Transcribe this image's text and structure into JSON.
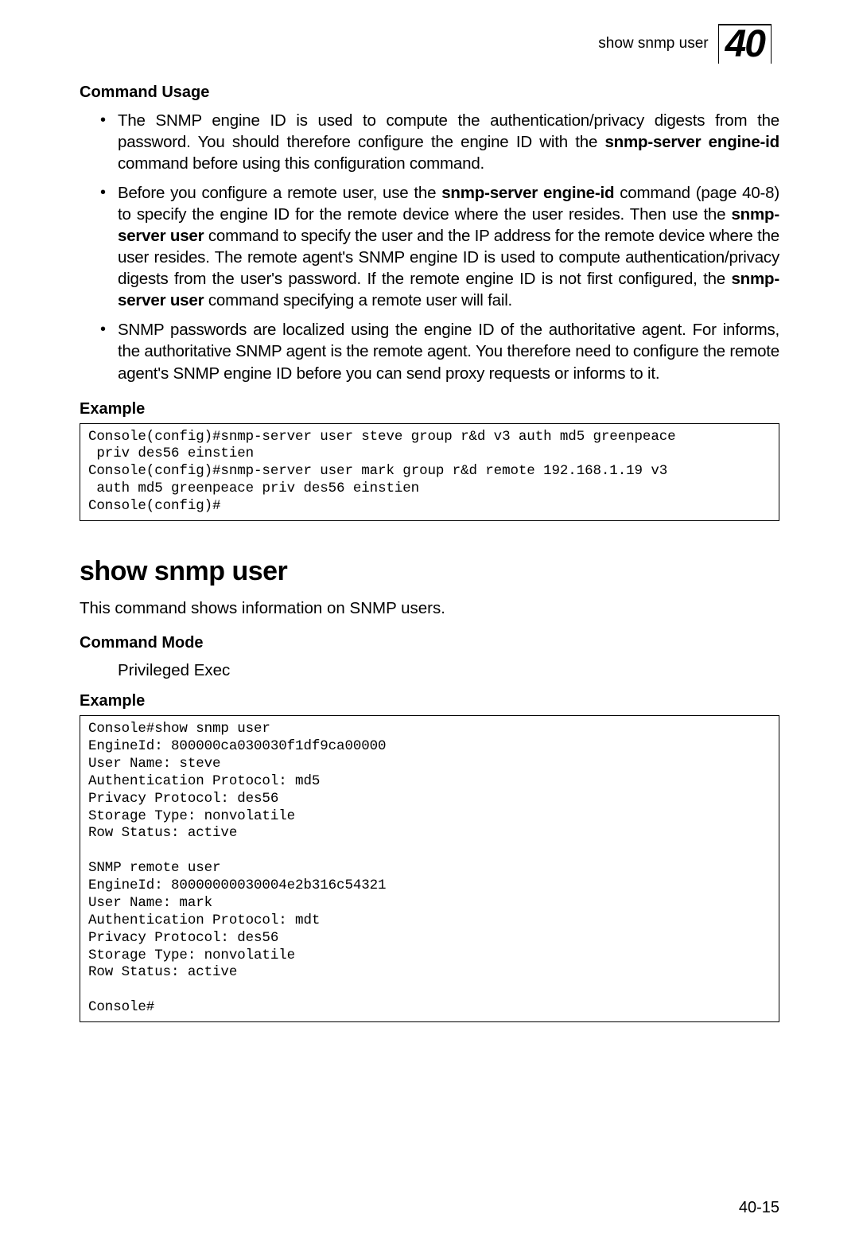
{
  "header": {
    "running_title": "show snmp user",
    "chapter": "40"
  },
  "command_usage": {
    "heading": "Command Usage",
    "bullet1_part1": "The SNMP engine ID is used to compute the authentication/privacy digests from the password. You should therefore configure the engine ID with the ",
    "bullet1_bold": "snmp-server engine-id",
    "bullet1_part2": " command before using this configuration command.",
    "bullet2_part1": "Before you configure a remote user, use the ",
    "bullet2_bold1": "snmp-server engine-id",
    "bullet2_part2": " command (page 40-8) to specify the engine ID for the remote device where the user resides. Then use the ",
    "bullet2_bold2": "snmp-server user",
    "bullet2_part3": " command to specify the user and the IP address for the remote device where the user resides. The remote agent's SNMP engine ID is used to compute authentication/privacy digests from the user's password. If the remote engine ID is not first configured, the ",
    "bullet2_bold3": "snmp-server user",
    "bullet2_part4": " command specifying a remote user will fail.",
    "bullet3": "SNMP passwords are localized using the engine ID of the authoritative agent. For informs, the authoritative SNMP agent is the remote agent. You therefore need to configure the remote agent's SNMP engine ID before you can send proxy requests or informs to it."
  },
  "example1": {
    "heading": "Example",
    "code": "Console(config)#snmp-server user steve group r&d v3 auth md5 greenpeace\n priv des56 einstien\nConsole(config)#snmp-server user mark group r&d remote 192.168.1.19 v3\n auth md5 greenpeace priv des56 einstien\nConsole(config)#"
  },
  "show_snmp_user": {
    "heading": "show snmp user",
    "description": "This command shows information on SNMP users.",
    "command_mode_heading": "Command Mode",
    "command_mode_value": "Privileged Exec"
  },
  "example2": {
    "heading": "Example",
    "code": "Console#show snmp user\nEngineId: 800000ca030030f1df9ca00000\nUser Name: steve\nAuthentication Protocol: md5\nPrivacy Protocol: des56\nStorage Type: nonvolatile\nRow Status: active\n\nSNMP remote user\nEngineId: 80000000030004e2b316c54321\nUser Name: mark\nAuthentication Protocol: mdt\nPrivacy Protocol: des56\nStorage Type: nonvolatile\nRow Status: active\n\nConsole#"
  },
  "footer": {
    "page_number": "40-15"
  }
}
